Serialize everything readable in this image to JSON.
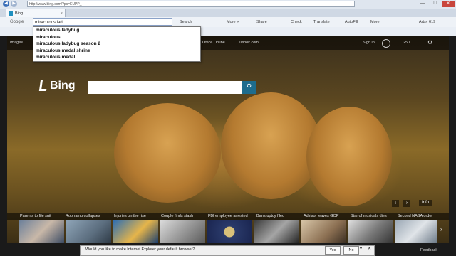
{
  "browser": {
    "address": "http://www.bing.com/?pc=EUPP_",
    "tab_title": "Bing",
    "window_controls": [
      "—",
      "☐",
      "✕"
    ]
  },
  "toolbar": {
    "google_label": "Google",
    "search_value": "miraculous lad",
    "items": [
      "Search",
      "More »",
      "Share",
      "Check",
      "Translate",
      "AutoFill",
      "More",
      "Artsy 619"
    ]
  },
  "suggestions": [
    "miraculous ladybug",
    "miraculous",
    "miraculous ladybug season 2",
    "miraculous medal shrine",
    "miraculous medal"
  ],
  "bing": {
    "logo": "Bing",
    "nav": [
      "Images",
      "Office Online",
      "Outlook.com",
      "Sign in",
      "250"
    ],
    "search_placeholder": "",
    "info": "Info"
  },
  "news": [
    "Parents to file suit",
    "Roo ramp collapses",
    "Injuries on the rise",
    "Couple finds stash",
    "FBI employee arrested",
    "Bankruptcy filed",
    "Advisor leaves GOP",
    "Star of musicals dies",
    "Second NASA order"
  ],
  "ie_prompt": {
    "text": "Would you like to make Internet Explorer your default browser?",
    "yes": "Yes",
    "no": "No"
  },
  "footer": {
    "feedback": "Feedback"
  }
}
